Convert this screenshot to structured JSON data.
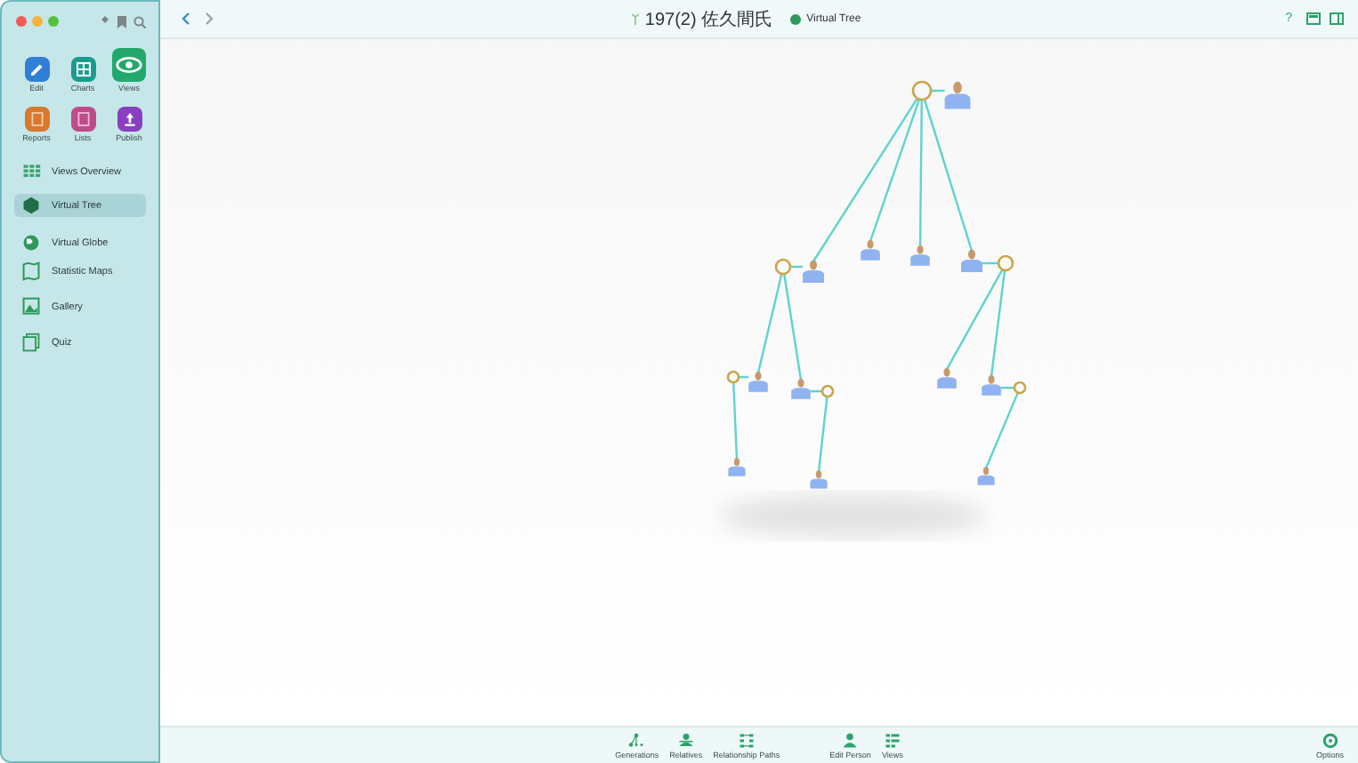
{
  "sidebar": {
    "tools": [
      {
        "label": "Edit",
        "color": "#2f7fd6",
        "selected": false
      },
      {
        "label": "Charts",
        "color": "#1a9b8f",
        "selected": false
      },
      {
        "label": "Views",
        "color": "#23a86b",
        "selected": true
      },
      {
        "label": "Reports",
        "color": "#d9782e",
        "selected": false
      },
      {
        "label": "Lists",
        "color": "#c04b8a",
        "selected": false
      },
      {
        "label": "Publish",
        "color": "#8a3fc0",
        "selected": false
      }
    ],
    "items": [
      {
        "label": "Views Overview",
        "selected": false
      },
      {
        "label": "Virtual Tree",
        "selected": true
      },
      {
        "label": "Virtual Globe",
        "selected": false
      },
      {
        "label": "Statistic Maps",
        "selected": false
      },
      {
        "label": "Gallery",
        "selected": false
      },
      {
        "label": "Quiz",
        "selected": false
      }
    ]
  },
  "header": {
    "person": "197(2) 佐久間氏",
    "view": "Virtual Tree",
    "help": "?"
  },
  "bottom_bar": {
    "groups": [
      [
        "Generations",
        "Relatives",
        "Relationship Paths"
      ],
      [
        "Edit Person",
        "Views"
      ]
    ],
    "options": "Options"
  }
}
